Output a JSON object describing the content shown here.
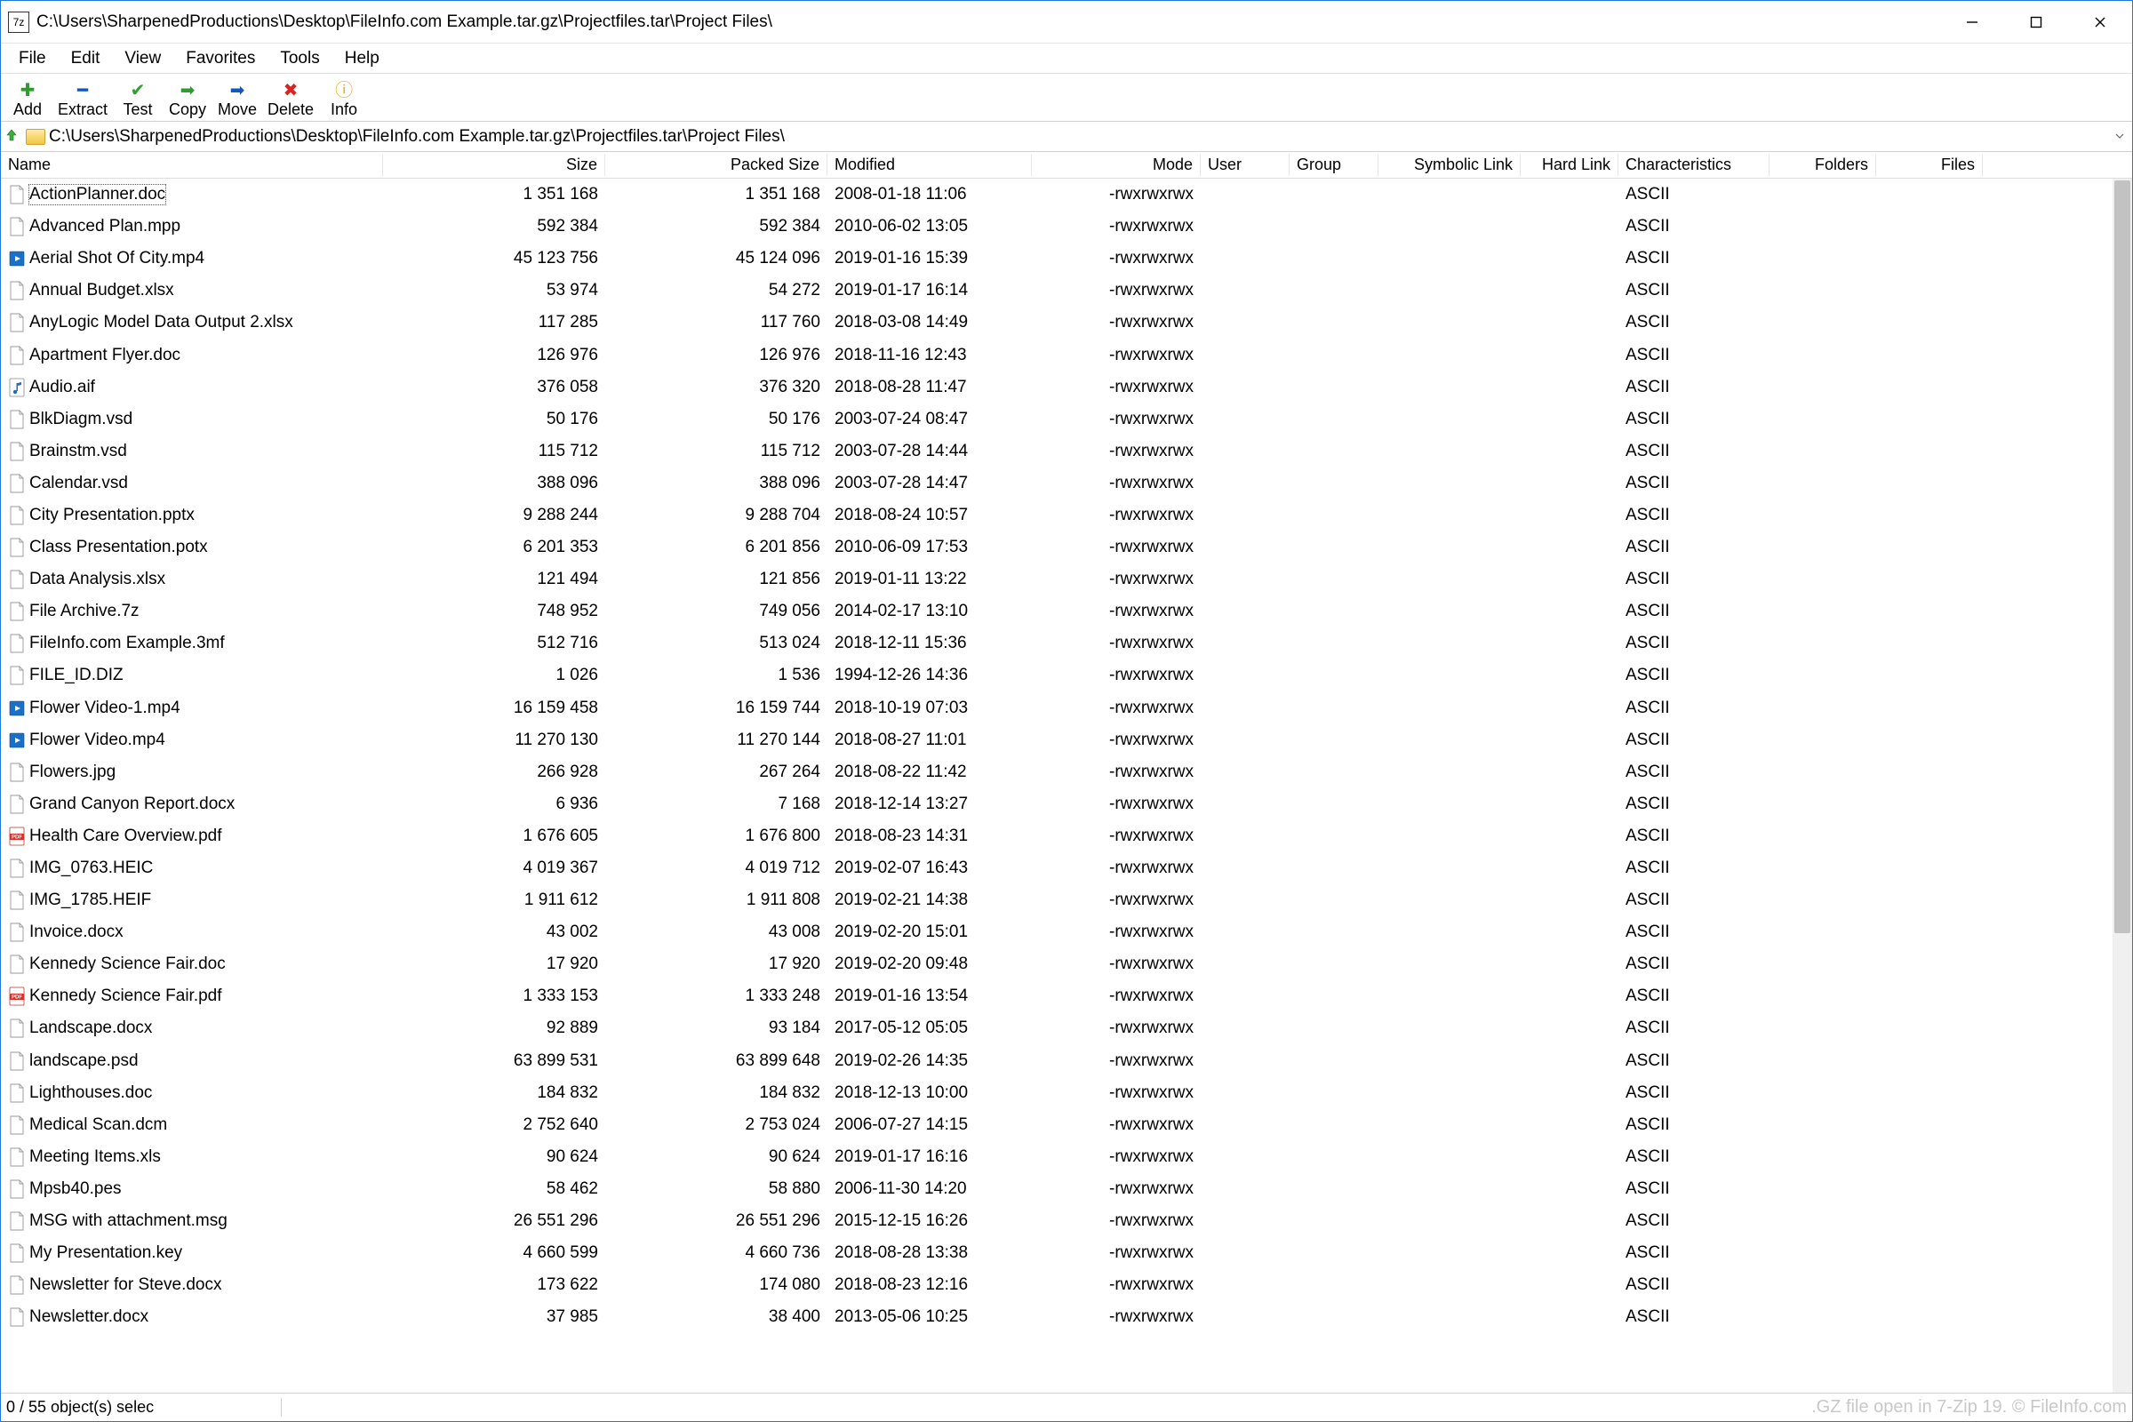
{
  "window": {
    "title": "C:\\Users\\SharpenedProductions\\Desktop\\FileInfo.com Example.tar.gz\\Projectfiles.tar\\Project Files\\",
    "app_icon_text": "7z"
  },
  "menu": [
    "File",
    "Edit",
    "View",
    "Favorites",
    "Tools",
    "Help"
  ],
  "toolbar": [
    {
      "label": "Add",
      "glyph": "✚",
      "color": "#2e9b2e"
    },
    {
      "label": "Extract",
      "glyph": "━",
      "color": "#1356c0"
    },
    {
      "label": "Test",
      "glyph": "✔",
      "color": "#29a329"
    },
    {
      "label": "Copy",
      "glyph": "➡",
      "color": "#2e9b2e"
    },
    {
      "label": "Move",
      "glyph": "➡",
      "color": "#1356c0"
    },
    {
      "label": "Delete",
      "glyph": "✖",
      "color": "#d22"
    },
    {
      "label": "Info",
      "glyph": "ⓘ",
      "color": "#e6a817"
    }
  ],
  "address": {
    "path": "C:\\Users\\SharpenedProductions\\Desktop\\FileInfo.com Example.tar.gz\\Projectfiles.tar\\Project Files\\"
  },
  "columns": [
    "Name",
    "Size",
    "Packed Size",
    "Modified",
    "Mode",
    "User",
    "Group",
    "Symbolic Link",
    "Hard Link",
    "Characteristics",
    "Folders",
    "Files"
  ],
  "files": [
    {
      "icon": "generic",
      "name": "ActionPlanner.doc",
      "size": "1 351 168",
      "packed": "1 351 168",
      "modified": "2008-01-18 11:06",
      "mode": "-rwxrwxrwx",
      "char": "ASCII",
      "selected": true
    },
    {
      "icon": "generic",
      "name": "Advanced Plan.mpp",
      "size": "592 384",
      "packed": "592 384",
      "modified": "2010-06-02 13:05",
      "mode": "-rwxrwxrwx",
      "char": "ASCII"
    },
    {
      "icon": "video",
      "name": "Aerial Shot Of City.mp4",
      "size": "45 123 756",
      "packed": "45 124 096",
      "modified": "2019-01-16 15:39",
      "mode": "-rwxrwxrwx",
      "char": "ASCII"
    },
    {
      "icon": "generic",
      "name": "Annual Budget.xlsx",
      "size": "53 974",
      "packed": "54 272",
      "modified": "2019-01-17 16:14",
      "mode": "-rwxrwxrwx",
      "char": "ASCII"
    },
    {
      "icon": "generic",
      "name": "AnyLogic Model Data Output 2.xlsx",
      "size": "117 285",
      "packed": "117 760",
      "modified": "2018-03-08 14:49",
      "mode": "-rwxrwxrwx",
      "char": "ASCII"
    },
    {
      "icon": "generic",
      "name": "Apartment Flyer.doc",
      "size": "126 976",
      "packed": "126 976",
      "modified": "2018-11-16 12:43",
      "mode": "-rwxrwxrwx",
      "char": "ASCII"
    },
    {
      "icon": "audio",
      "name": "Audio.aif",
      "size": "376 058",
      "packed": "376 320",
      "modified": "2018-08-28 11:47",
      "mode": "-rwxrwxrwx",
      "char": "ASCII"
    },
    {
      "icon": "generic",
      "name": "BlkDiagm.vsd",
      "size": "50 176",
      "packed": "50 176",
      "modified": "2003-07-24 08:47",
      "mode": "-rwxrwxrwx",
      "char": "ASCII"
    },
    {
      "icon": "generic",
      "name": "Brainstm.vsd",
      "size": "115 712",
      "packed": "115 712",
      "modified": "2003-07-28 14:44",
      "mode": "-rwxrwxrwx",
      "char": "ASCII"
    },
    {
      "icon": "generic",
      "name": "Calendar.vsd",
      "size": "388 096",
      "packed": "388 096",
      "modified": "2003-07-28 14:47",
      "mode": "-rwxrwxrwx",
      "char": "ASCII"
    },
    {
      "icon": "generic",
      "name": "City Presentation.pptx",
      "size": "9 288 244",
      "packed": "9 288 704",
      "modified": "2018-08-24 10:57",
      "mode": "-rwxrwxrwx",
      "char": "ASCII"
    },
    {
      "icon": "generic",
      "name": "Class Presentation.potx",
      "size": "6 201 353",
      "packed": "6 201 856",
      "modified": "2010-06-09 17:53",
      "mode": "-rwxrwxrwx",
      "char": "ASCII"
    },
    {
      "icon": "generic",
      "name": "Data Analysis.xlsx",
      "size": "121 494",
      "packed": "121 856",
      "modified": "2019-01-11 13:22",
      "mode": "-rwxrwxrwx",
      "char": "ASCII"
    },
    {
      "icon": "generic",
      "name": "File Archive.7z",
      "size": "748 952",
      "packed": "749 056",
      "modified": "2014-02-17 13:10",
      "mode": "-rwxrwxrwx",
      "char": "ASCII"
    },
    {
      "icon": "generic",
      "name": "FileInfo.com Example.3mf",
      "size": "512 716",
      "packed": "513 024",
      "modified": "2018-12-11 15:36",
      "mode": "-rwxrwxrwx",
      "char": "ASCII"
    },
    {
      "icon": "generic",
      "name": "FILE_ID.DIZ",
      "size": "1 026",
      "packed": "1 536",
      "modified": "1994-12-26 14:36",
      "mode": "-rwxrwxrwx",
      "char": "ASCII"
    },
    {
      "icon": "video",
      "name": "Flower Video-1.mp4",
      "size": "16 159 458",
      "packed": "16 159 744",
      "modified": "2018-10-19 07:03",
      "mode": "-rwxrwxrwx",
      "char": "ASCII"
    },
    {
      "icon": "video",
      "name": "Flower Video.mp4",
      "size": "11 270 130",
      "packed": "11 270 144",
      "modified": "2018-08-27 11:01",
      "mode": "-rwxrwxrwx",
      "char": "ASCII"
    },
    {
      "icon": "generic",
      "name": "Flowers.jpg",
      "size": "266 928",
      "packed": "267 264",
      "modified": "2018-08-22 11:42",
      "mode": "-rwxrwxrwx",
      "char": "ASCII"
    },
    {
      "icon": "generic",
      "name": "Grand Canyon Report.docx",
      "size": "6 936",
      "packed": "7 168",
      "modified": "2018-12-14 13:27",
      "mode": "-rwxrwxrwx",
      "char": "ASCII"
    },
    {
      "icon": "pdf",
      "name": "Health Care Overview.pdf",
      "size": "1 676 605",
      "packed": "1 676 800",
      "modified": "2018-08-23 14:31",
      "mode": "-rwxrwxrwx",
      "char": "ASCII"
    },
    {
      "icon": "generic",
      "name": "IMG_0763.HEIC",
      "size": "4 019 367",
      "packed": "4 019 712",
      "modified": "2019-02-07 16:43",
      "mode": "-rwxrwxrwx",
      "char": "ASCII"
    },
    {
      "icon": "generic",
      "name": "IMG_1785.HEIF",
      "size": "1 911 612",
      "packed": "1 911 808",
      "modified": "2019-02-21 14:38",
      "mode": "-rwxrwxrwx",
      "char": "ASCII"
    },
    {
      "icon": "generic",
      "name": "Invoice.docx",
      "size": "43 002",
      "packed": "43 008",
      "modified": "2019-02-20 15:01",
      "mode": "-rwxrwxrwx",
      "char": "ASCII"
    },
    {
      "icon": "generic",
      "name": "Kennedy Science Fair.doc",
      "size": "17 920",
      "packed": "17 920",
      "modified": "2019-02-20 09:48",
      "mode": "-rwxrwxrwx",
      "char": "ASCII"
    },
    {
      "icon": "pdf",
      "name": "Kennedy Science Fair.pdf",
      "size": "1 333 153",
      "packed": "1 333 248",
      "modified": "2019-01-16 13:54",
      "mode": "-rwxrwxrwx",
      "char": "ASCII"
    },
    {
      "icon": "generic",
      "name": "Landscape.docx",
      "size": "92 889",
      "packed": "93 184",
      "modified": "2017-05-12 05:05",
      "mode": "-rwxrwxrwx",
      "char": "ASCII"
    },
    {
      "icon": "generic",
      "name": "landscape.psd",
      "size": "63 899 531",
      "packed": "63 899 648",
      "modified": "2019-02-26 14:35",
      "mode": "-rwxrwxrwx",
      "char": "ASCII"
    },
    {
      "icon": "generic",
      "name": "Lighthouses.doc",
      "size": "184 832",
      "packed": "184 832",
      "modified": "2018-12-13 10:00",
      "mode": "-rwxrwxrwx",
      "char": "ASCII"
    },
    {
      "icon": "generic",
      "name": "Medical Scan.dcm",
      "size": "2 752 640",
      "packed": "2 753 024",
      "modified": "2006-07-27 14:15",
      "mode": "-rwxrwxrwx",
      "char": "ASCII"
    },
    {
      "icon": "generic",
      "name": "Meeting Items.xls",
      "size": "90 624",
      "packed": "90 624",
      "modified": "2019-01-17 16:16",
      "mode": "-rwxrwxrwx",
      "char": "ASCII"
    },
    {
      "icon": "generic",
      "name": "Mpsb40.pes",
      "size": "58 462",
      "packed": "58 880",
      "modified": "2006-11-30 14:20",
      "mode": "-rwxrwxrwx",
      "char": "ASCII"
    },
    {
      "icon": "generic",
      "name": "MSG with attachment.msg",
      "size": "26 551 296",
      "packed": "26 551 296",
      "modified": "2015-12-15 16:26",
      "mode": "-rwxrwxrwx",
      "char": "ASCII"
    },
    {
      "icon": "generic",
      "name": "My Presentation.key",
      "size": "4 660 599",
      "packed": "4 660 736",
      "modified": "2018-08-28 13:38",
      "mode": "-rwxrwxrwx",
      "char": "ASCII"
    },
    {
      "icon": "generic",
      "name": "Newsletter for Steve.docx",
      "size": "173 622",
      "packed": "174 080",
      "modified": "2018-08-23 12:16",
      "mode": "-rwxrwxrwx",
      "char": "ASCII"
    },
    {
      "icon": "generic",
      "name": "Newsletter.docx",
      "size": "37 985",
      "packed": "38 400",
      "modified": "2013-05-06 10:25",
      "mode": "-rwxrwxrwx",
      "char": "ASCII"
    }
  ],
  "status": {
    "left": "0 / 55 object(s) selec",
    "right": ".GZ file open in 7-Zip 19. © FileInfo.com"
  }
}
